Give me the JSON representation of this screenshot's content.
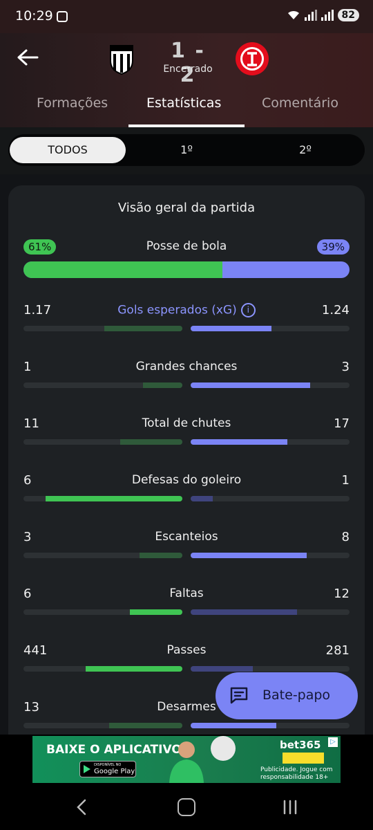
{
  "status_bar": {
    "time": "10:29",
    "battery": "82"
  },
  "match": {
    "home_team_icon": "santos-crest-icon",
    "away_team_icon": "internacional-crest-icon",
    "score": "1 - 2",
    "status": "Encerrado"
  },
  "tabs": [
    {
      "label": "Formações",
      "active": false
    },
    {
      "label": "Estatísticas",
      "active": true
    },
    {
      "label": "Comentário",
      "active": false
    }
  ],
  "periods": [
    {
      "label": "TODOS",
      "active": true
    },
    {
      "label": "1º",
      "active": false
    },
    {
      "label": "2º",
      "active": false
    }
  ],
  "card": {
    "title": "Visão geral da partida",
    "possession": {
      "label": "Posse de bola",
      "home": "61%",
      "away": "39%",
      "home_fraction": 0.61
    }
  },
  "colors": {
    "home": "#3fc453",
    "home_dim": "#2f5a3a",
    "away": "#7b84f5",
    "away_dim": "#3f447d",
    "track": "#2d3134"
  },
  "stats": [
    {
      "label": "Gols esperados (xG)",
      "home": "1.17",
      "away": "1.24",
      "home_fraction": 0.49,
      "away_fraction": 0.51,
      "winner": "away",
      "has_info": true,
      "info_glyph": "i"
    },
    {
      "label": "Grandes chances",
      "home": "1",
      "away": "3",
      "home_fraction": 0.25,
      "away_fraction": 0.75,
      "winner": "away"
    },
    {
      "label": "Total de chutes",
      "home": "11",
      "away": "17",
      "home_fraction": 0.39,
      "away_fraction": 0.61,
      "winner": "away"
    },
    {
      "label": "Defesas do goleiro",
      "home": "6",
      "away": "1",
      "home_fraction": 0.86,
      "away_fraction": 0.14,
      "winner": "home"
    },
    {
      "label": "Escanteios",
      "home": "3",
      "away": "8",
      "home_fraction": 0.27,
      "away_fraction": 0.73,
      "winner": "away"
    },
    {
      "label": "Faltas",
      "home": "6",
      "away": "12",
      "home_fraction": 0.33,
      "away_fraction": 0.67,
      "winner": "home"
    },
    {
      "label": "Passes",
      "home": "441",
      "away": "281",
      "home_fraction": 0.61,
      "away_fraction": 0.39,
      "winner": "home"
    },
    {
      "label": "Desarmes",
      "home": "13",
      "away": "",
      "home_fraction": 0.46,
      "away_fraction": 0.54,
      "winner": "away"
    }
  ],
  "chat_button": {
    "label": "Bate-papo"
  },
  "ad": {
    "headline": "BAIXE O APLICATIVO",
    "store_small": "DISPONÍVEL NO",
    "store_name": "Google Play",
    "brand": "bet365",
    "note_line1": "Publicidade. Jogue com",
    "note_line2": "responsabilidade 18+"
  }
}
